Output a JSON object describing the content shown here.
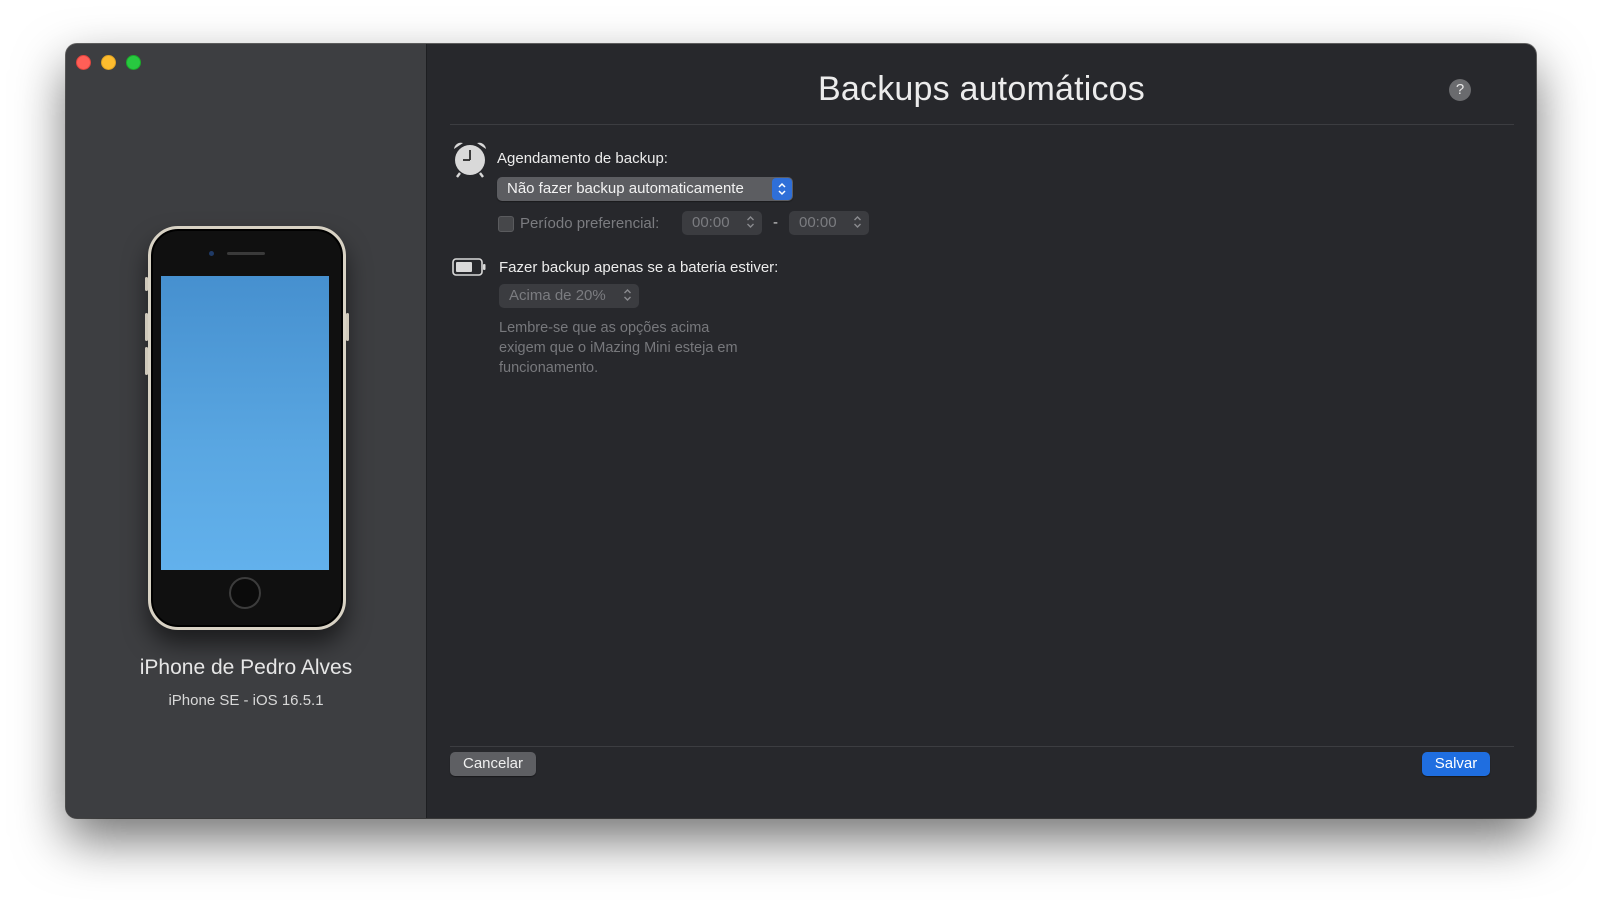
{
  "window": {
    "traffic_lights": [
      "close",
      "minimize",
      "maximize"
    ]
  },
  "sidebar": {
    "device_name": "iPhone de Pedro Alves",
    "device_model": "iPhone SE - iOS 16.5.1"
  },
  "main": {
    "title": "Backups automáticos",
    "help_label": "?",
    "schedule": {
      "icon": "alarm-clock-icon",
      "label": "Agendamento de backup:",
      "selected_option": "Não fazer backup automaticamente",
      "preferred_period_label": "Período preferencial:",
      "preferred_period_checked": false,
      "start_time": "00:00",
      "separator": "-",
      "end_time": "00:00"
    },
    "battery": {
      "icon": "battery-icon",
      "label": "Fazer backup apenas se a bateria estiver:",
      "selected_option": "Acima de 20%",
      "note": "Lembre-se que as opções acima exigem que o iMazing Mini esteja em funcionamento."
    },
    "buttons": {
      "cancel": "Cancelar",
      "save": "Salvar"
    }
  },
  "colors": {
    "sidebar_bg": "#3d3e41",
    "main_bg": "#27282c",
    "accent_blue": "#1f6ee0",
    "close": "#ff5f57",
    "minimize": "#febc2e",
    "maximize": "#28c840"
  }
}
